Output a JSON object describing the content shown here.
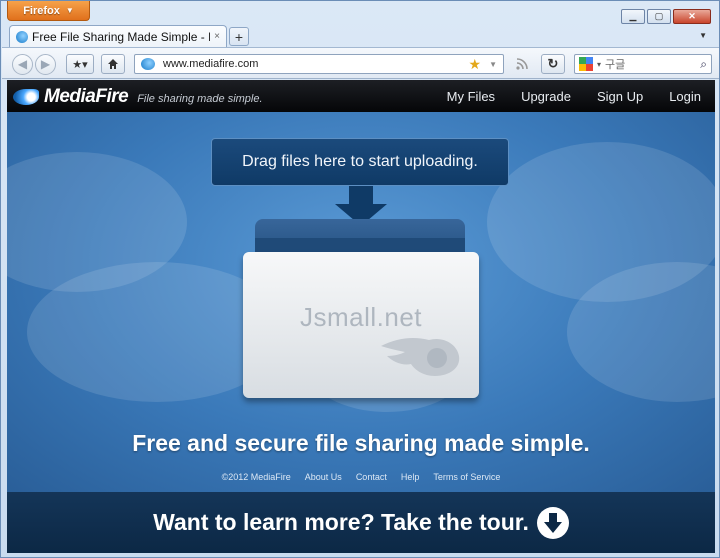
{
  "browser": {
    "menu_button_label": "Firefox",
    "tab_title": "Free File Sharing Made Simple - MediaFire",
    "tab_close": "×",
    "new_tab_label": "+",
    "url": "www.mediafire.com",
    "search_engine_text": "구글",
    "window_controls": {
      "minimize": "▁",
      "maximize": "▢",
      "close": "✕"
    },
    "icons": {
      "back": "arrow-left-icon",
      "forward": "arrow-right-icon",
      "bookmarks": "bookmark-star-icon",
      "home": "home-icon",
      "bookmark_star": "star-icon",
      "rss": "rss-icon",
      "reload": "reload-icon",
      "search": "magnifier-icon"
    }
  },
  "site": {
    "brand_name": "MediaFire",
    "tagline": "File sharing made simple.",
    "nav": [
      {
        "label": "My Files"
      },
      {
        "label": "Upgrade"
      },
      {
        "label": "Sign Up"
      },
      {
        "label": "Login"
      }
    ]
  },
  "hero": {
    "upload_prompt": "Drag files here to start uploading.",
    "watermark_text": "Jsmall.net",
    "headline": "Free and secure file sharing made simple.",
    "footer_links": [
      "©2012 MediaFire",
      "About Us",
      "Contact",
      "Help",
      "Terms of Service"
    ]
  },
  "tour": {
    "label": "Want to learn more? Take the tour.",
    "icon": "arrow-down-circle-icon"
  },
  "colors": {
    "firefox_button": "#e0701c",
    "header_bg": "#0a0b0e",
    "hero_blue": "#3a79b9",
    "tour_bar": "#0c2845"
  }
}
